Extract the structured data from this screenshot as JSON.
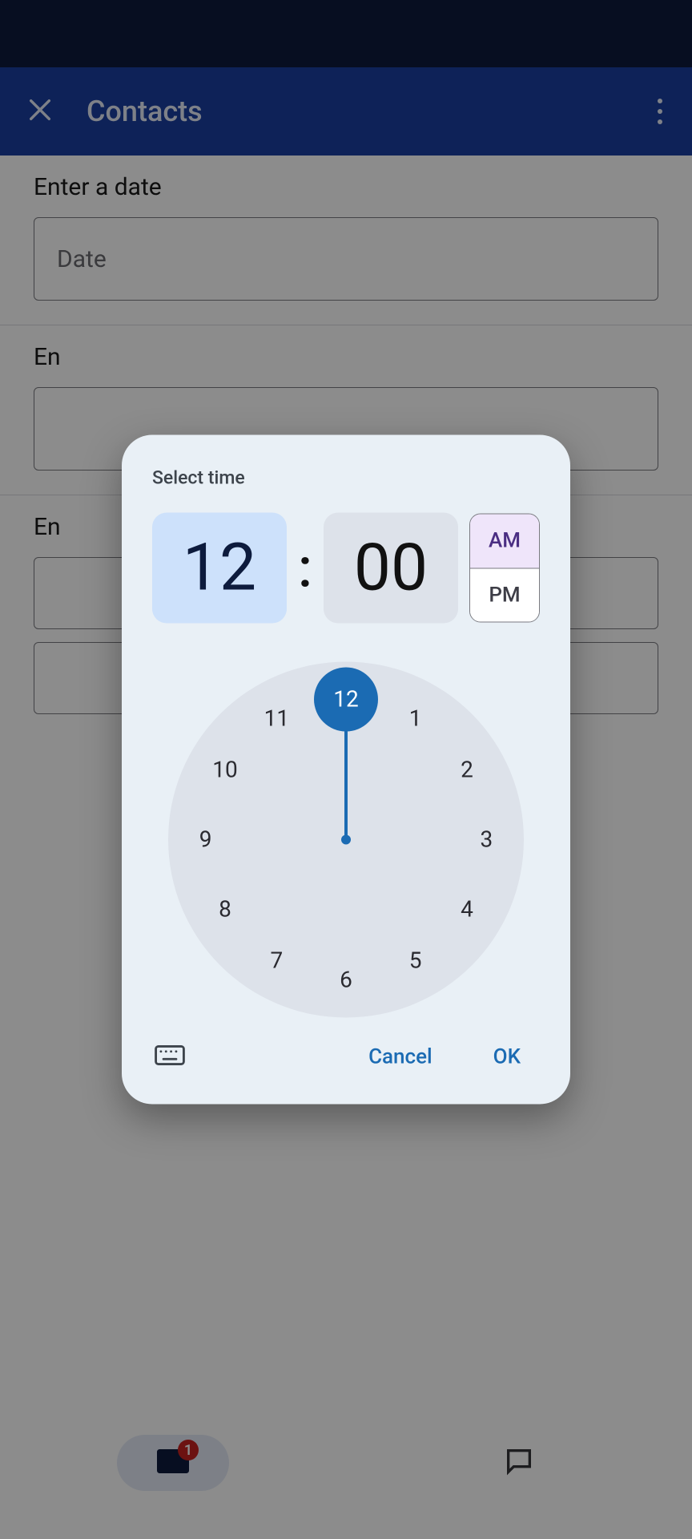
{
  "appbar": {
    "title": "Contacts"
  },
  "form": {
    "date_section_label": "Enter a date",
    "date_placeholder": "Date",
    "time_section_label": "En",
    "extra_section_label": "En"
  },
  "bottomnav": {
    "mail_badge": "1"
  },
  "dialog": {
    "title": "Select time",
    "hour": "12",
    "minute": "00",
    "colon": ":",
    "am_label": "AM",
    "pm_label": "PM",
    "selected_period": "AM",
    "clock_numbers": [
      "12",
      "1",
      "2",
      "3",
      "4",
      "5",
      "6",
      "7",
      "8",
      "9",
      "10",
      "11"
    ],
    "selected_clock": "12",
    "cancel": "Cancel",
    "ok": "OK"
  }
}
